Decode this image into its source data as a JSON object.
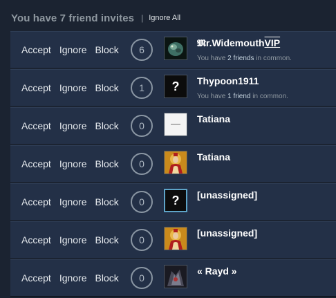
{
  "header": {
    "title": "You have 7 friend invites",
    "separator": "|",
    "ignore_all": "Ignore All"
  },
  "actions": {
    "accept": "Accept",
    "ignore": "Ignore",
    "block": "Block"
  },
  "invites": [
    {
      "count": "6",
      "name_prefix": "𝕸r.Widemouth",
      "name_vip": "VIP",
      "common_prefix": "You have ",
      "common_count": "2 friends",
      "common_suffix": " in common.",
      "avatar": "green-creature-avatar"
    },
    {
      "count": "1",
      "name": "Thypoon1911",
      "common_prefix": "You have ",
      "common_count": "1 friend",
      "common_suffix": " in common.",
      "avatar": "question-mark-avatar"
    },
    {
      "count": "0",
      "name": "Tatiana",
      "avatar": "white-avatar"
    },
    {
      "count": "0",
      "name": "Tatiana",
      "avatar": "icon-portrait-avatar"
    },
    {
      "count": "0",
      "name": "[unassigned]",
      "avatar": "question-mark-avatar"
    },
    {
      "count": "0",
      "name": "[unassigned]",
      "avatar": "icon-portrait-avatar"
    },
    {
      "count": "0",
      "name": "« Rayd »",
      "avatar": "dark-armor-avatar"
    }
  ],
  "avatar_text": {
    "question_mark": "?"
  }
}
